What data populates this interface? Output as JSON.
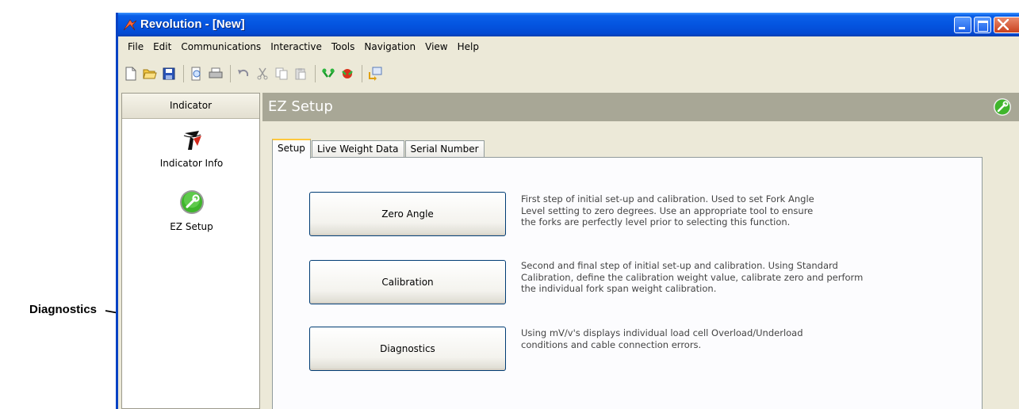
{
  "callout": {
    "label": "Diagnostics"
  },
  "window": {
    "title": "Revolution - [New]",
    "accent": "#0455e0"
  },
  "menu": [
    "File",
    "Edit",
    "Communications",
    "Interactive",
    "Tools",
    "Navigation",
    "View",
    "Help"
  ],
  "toolbar": {
    "icons": [
      "new-file-icon",
      "open-folder-icon",
      "save-icon",
      "print-preview-icon",
      "print-icon",
      "undo-icon",
      "cut-icon",
      "copy-icon",
      "paste-icon",
      "connect-icon",
      "disconnect-icon",
      "transfer-icon"
    ]
  },
  "sidebar": {
    "header": "Indicator",
    "items": [
      {
        "label": "Indicator Info",
        "icon": "indicator-logo-icon"
      },
      {
        "label": "EZ Setup",
        "icon": "ez-setup-icon"
      }
    ]
  },
  "main": {
    "title": "EZ Setup",
    "tabs": [
      {
        "label": "Setup",
        "active": true
      },
      {
        "label": "Live Weight Data",
        "active": false
      },
      {
        "label": "Serial Number",
        "active": false
      }
    ],
    "actions": [
      {
        "button": "Zero Angle",
        "description": [
          "First step of initial set-up and calibration. Used to set Fork Angle",
          "Level setting to zero degrees. Use an appropriate tool to ensure",
          "the forks are perfectly level prior to selecting this function."
        ]
      },
      {
        "button": "Calibration",
        "description": [
          "Second and final step of initial set-up and calibration. Using Standard",
          "Calibration, define the calibration weight value, calibrate zero and perform",
          "the individual fork span weight calibration."
        ]
      },
      {
        "button": "Diagnostics",
        "description": [
          "Using mV/v's displays individual load cell Overload/Underload",
          "conditions and cable connection errors."
        ]
      }
    ]
  }
}
